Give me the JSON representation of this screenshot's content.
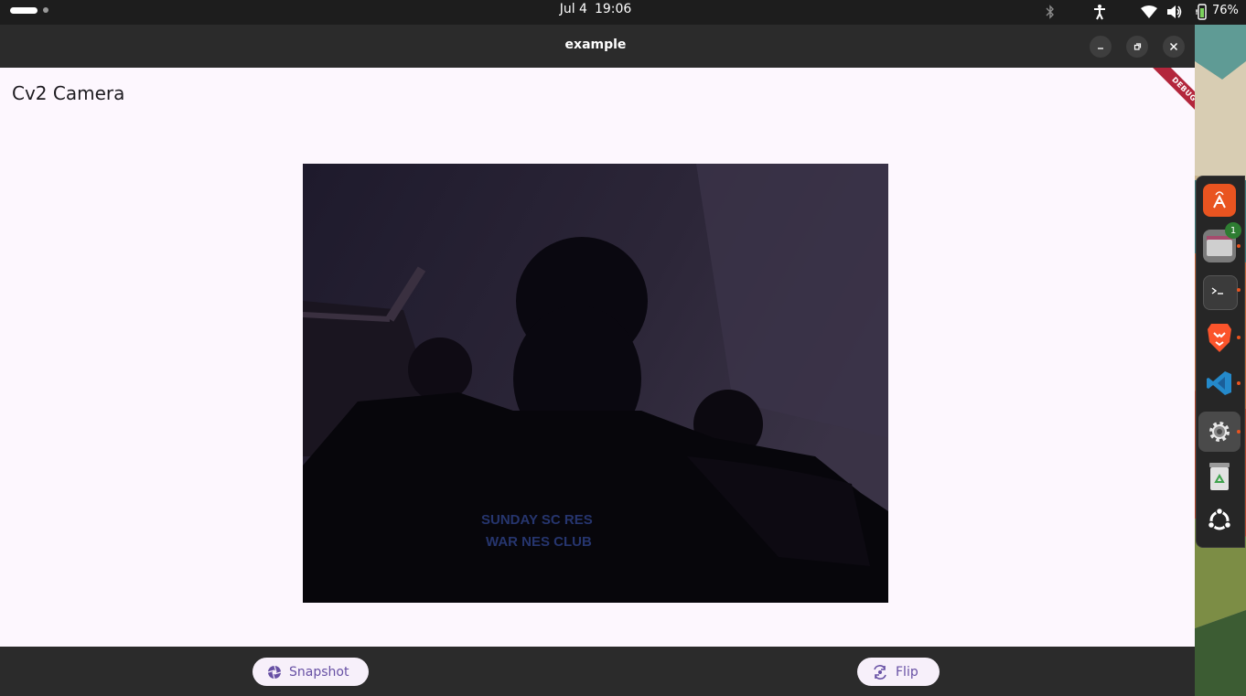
{
  "system_bar": {
    "date": "Jul 4",
    "time": "19:06",
    "battery": "76%"
  },
  "window": {
    "title": "example"
  },
  "app": {
    "title": "Cv2 Camera",
    "debug_banner": "DEBUG",
    "camera_text_line1": "SUNDAY SC  RES",
    "camera_text_line2": "WAR NES  CLUB"
  },
  "actions": {
    "snapshot_label": "Snapshot",
    "flip_label": "Flip"
  },
  "dock": {
    "files_badge": "1"
  },
  "colors": {
    "accent": "#6750a4",
    "surface": "#fdf7fe",
    "chrome": "#2b2b2b",
    "debug": "#b3263c"
  }
}
